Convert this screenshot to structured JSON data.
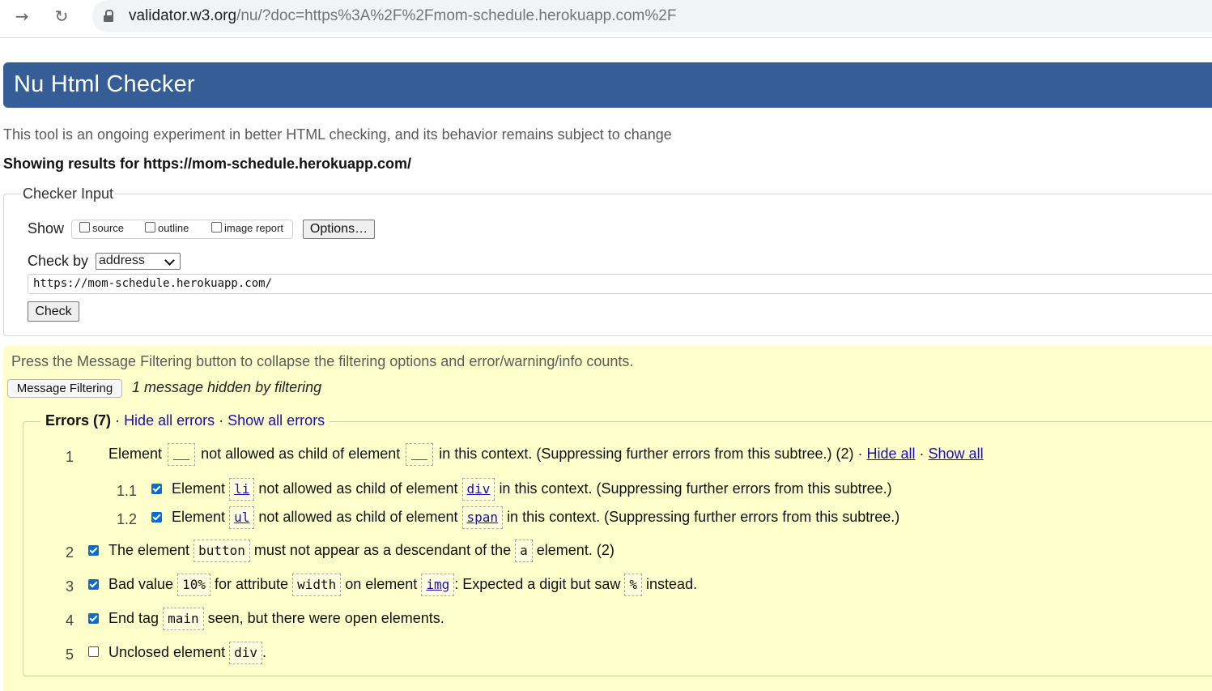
{
  "browser": {
    "url_host": "validator.w3.org",
    "url_path": "/nu/?doc=https%3A%2F%2Fmom-schedule.herokuapp.com%2F"
  },
  "header": {
    "title": "Nu Html Checker",
    "intro": "This tool is an ongoing experiment in better HTML checking, and its behavior remains subject to change",
    "showing_results": "Showing results for https://mom-schedule.herokuapp.com/"
  },
  "checker_input": {
    "legend": "Checker Input",
    "show_label": "Show",
    "show_options": [
      {
        "label": "source",
        "checked": false
      },
      {
        "label": "outline",
        "checked": false
      },
      {
        "label": "image report",
        "checked": false
      }
    ],
    "options_button": "Options…",
    "check_by_label": "Check by",
    "check_by_value": "address",
    "address_value": "https://mom-schedule.herokuapp.com/",
    "check_button": "Check"
  },
  "filtering": {
    "hint": "Press the Message Filtering button to collapse the filtering options and error/warning/info counts.",
    "button": "Message Filtering",
    "hidden_message": "1 message hidden by filtering"
  },
  "errors": {
    "heading": "Errors (7)",
    "separator": "·",
    "hide_all": "Hide all errors",
    "show_all": "Show all errors",
    "items": [
      {
        "num": "1",
        "part1": "Element",
        "part2": "not allowed as child of element",
        "part3": "in this context. (Suppressing further errors from this subtree.) (2) ·",
        "hide": "Hide all",
        "dot": "·",
        "show": "Show all"
      },
      {
        "num": "1.1",
        "checked": true,
        "pre": "Element",
        "code1": "li",
        "mid": "not allowed as child of element",
        "code2": "div",
        "post": "in this context. (Suppressing further errors from this subtree.)"
      },
      {
        "num": "1.2",
        "checked": true,
        "pre": "Element",
        "code1": "ul",
        "mid": "not allowed as child of element",
        "code2": "span",
        "post": "in this context. (Suppressing further errors from this subtree.)"
      },
      {
        "num": "2",
        "checked": true,
        "pre": "The element",
        "code1": "button",
        "mid": "must not appear as a descendant of the",
        "code2": "a",
        "post": "element. (2)"
      },
      {
        "num": "3",
        "checked": true,
        "pre": "Bad value",
        "code1": "10%",
        "mid": "for attribute",
        "code2": "width",
        "mid2": "on element",
        "code3": "img",
        "mid3": ": Expected a digit but saw",
        "code4": "%",
        "post": "instead."
      },
      {
        "num": "4",
        "checked": true,
        "pre": "End tag",
        "code1": "main",
        "post": "seen, but there were open elements."
      },
      {
        "num": "5",
        "checked": false,
        "pre": "Unclosed element",
        "code1": "div",
        "post": "."
      }
    ]
  }
}
